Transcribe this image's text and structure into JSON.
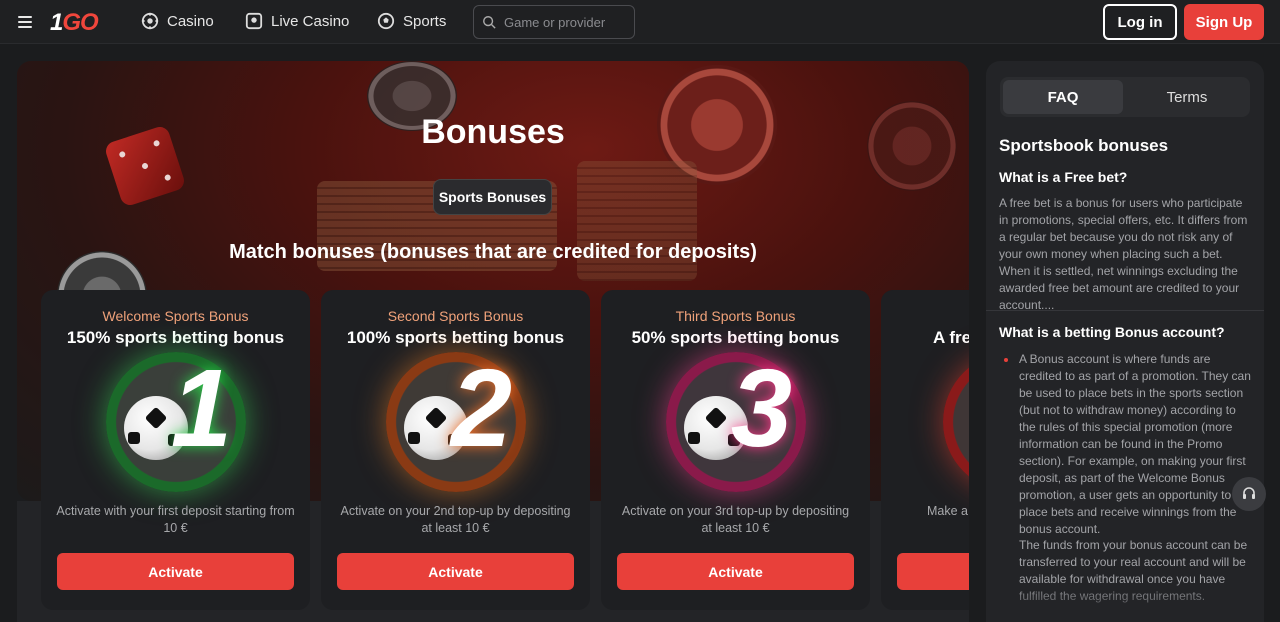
{
  "header": {
    "logo": {
      "one": "1",
      "go": "GO"
    },
    "nav": [
      {
        "label": "Casino",
        "icon": "casino-chip-icon"
      },
      {
        "label": "Live Casino",
        "icon": "live-casino-icon"
      },
      {
        "label": "Sports",
        "icon": "soccer-ball-icon"
      }
    ],
    "search_placeholder": "Game or provider",
    "login_label": "Log in",
    "signup_label": "Sign Up"
  },
  "hero": {
    "title": "Bonuses",
    "category_pill": "Sports Bonuses",
    "section_title": "Match bonuses (bonuses that are credited for deposits)"
  },
  "cards": [
    {
      "eyebrow": "Welcome Sports Bonus",
      "title": "150% sports betting bonus",
      "number": "1",
      "desc": "Activate with your first deposit starting from 10 €",
      "button": "Activate"
    },
    {
      "eyebrow": "Second Sports Bonus",
      "title": "100% sports betting bonus",
      "number": "2",
      "desc": "Activate on your 2nd top-up by depositing at least 10 €",
      "button": "Activate"
    },
    {
      "eyebrow": "Third Sports Bonus",
      "title": "50% sports betting bonus",
      "number": "3",
      "desc": "Activate on your 3rd top-up by depositing at least 10 €",
      "button": "Activate"
    },
    {
      "eyebrow": "",
      "title": "A fre",
      "number": "",
      "desc": "Make a d",
      "button": ""
    }
  ],
  "panel": {
    "tabs": [
      {
        "label": "FAQ",
        "active": true
      },
      {
        "label": "Terms",
        "active": false
      }
    ],
    "heading": "Sportsbook bonuses",
    "q1": "What is a Free bet?",
    "a1": "A free bet is a bonus for users who participate in promotions, special offers, etc. It differs from a regular bet because you do not risk any of your own money when placing such a bet. When it is settled, net winnings excluding the awarded free bet amount are credited to your account....",
    "q2": "What is a betting Bonus account?",
    "a2": "A Bonus account is where funds are credited to as part of a promotion. They can be used to place bets in the sports section (but not to withdraw money) according to the rules of this special promotion (more information can be found in the Promo section). For example, on making your first deposit, as part of the Welcome Bonus promotion, a user gets an opportunity to place bets and receive winnings from the bonus account.",
    "a3": "The funds from your bonus account can be transferred to your real account and will be available for withdrawal once you have fulfilled the wagering requirements."
  },
  "colors": {
    "accent": "#e8403a",
    "eyebrow": "#f0a27a",
    "background": "#1b1c1e",
    "card": "#1e1f22"
  }
}
